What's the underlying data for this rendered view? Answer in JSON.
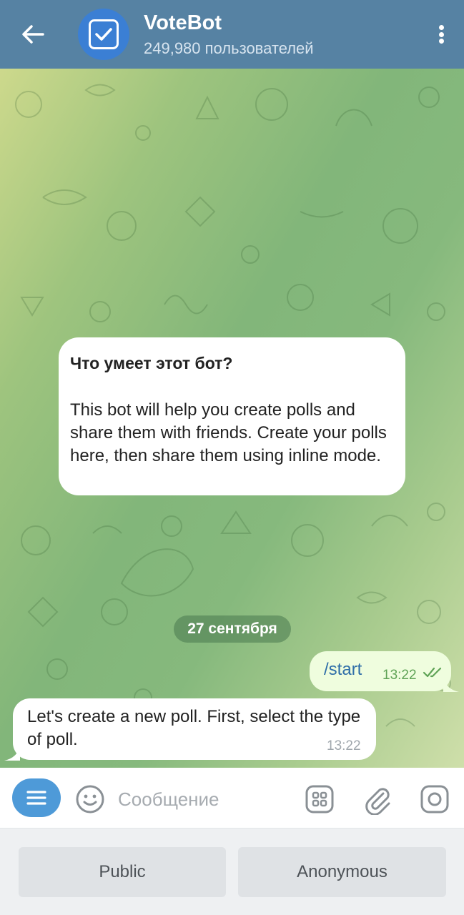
{
  "header": {
    "title": "VoteBot",
    "subtitle": "249,980 пользователей"
  },
  "info_card": {
    "title": "Что умеет этот бот?",
    "text": "This bot will help you create polls and share them with friends. Create your polls here, then share them using inline mode."
  },
  "date_separator": "27 сентября",
  "messages": [
    {
      "direction": "out",
      "text": "/start",
      "time": "13:22",
      "status": "read"
    },
    {
      "direction": "in",
      "text": "Let's create a new poll. First, select the type of poll.",
      "time": "13:22"
    }
  ],
  "input": {
    "placeholder": "Сообщение",
    "value": ""
  },
  "keyboard": {
    "buttons": [
      "Public",
      "Anonymous"
    ]
  },
  "colors": {
    "header": "#5682a3",
    "accent": "#4e9ad8",
    "outgoing_bubble": "#effdde",
    "read_check": "#5fa356"
  },
  "icons": [
    "back-arrow-icon",
    "checkbox-icon",
    "more-vertical-icon",
    "bot-menu-icon",
    "emoji-icon",
    "keyboard-grid-icon",
    "paperclip-icon",
    "camera-icon",
    "double-check-icon"
  ]
}
